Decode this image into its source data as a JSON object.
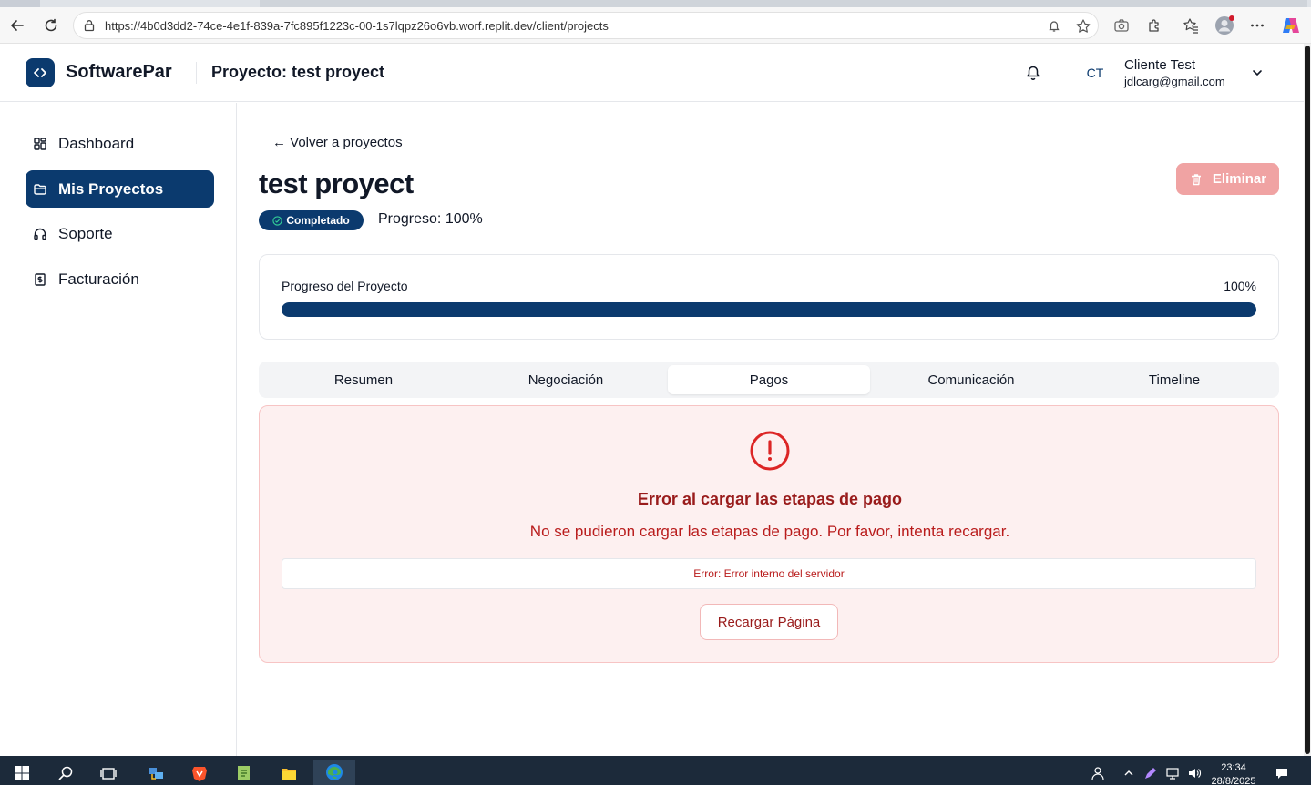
{
  "browser": {
    "url": "https://4b0d3dd2-74ce-4e1f-839a-7fc895f1223c-00-1s7lqpz26o6vb.worf.replit.dev/client/projects",
    "icons": [
      "back-icon",
      "refresh-icon",
      "lock-icon",
      "read-aloud-icon",
      "favorite-icon",
      "screenshot-icon",
      "extensions-icon",
      "favorites-icon",
      "profile-icon",
      "more-icon",
      "copilot-icon"
    ]
  },
  "header": {
    "brand": "SoftwarePar",
    "title": "Proyecto: test proyect",
    "user_initials": "CT",
    "user_name": "Cliente Test",
    "user_email": "jdlcarg@gmail.com"
  },
  "sidebar": {
    "items": [
      {
        "label": "Dashboard",
        "icon": "grid-icon",
        "active": false
      },
      {
        "label": "Mis Proyectos",
        "icon": "folder-icon",
        "active": true
      },
      {
        "label": "Soporte",
        "icon": "headphones-icon",
        "active": false
      },
      {
        "label": "Facturación",
        "icon": "receipt-icon",
        "active": false
      }
    ]
  },
  "main": {
    "back_link": "← Volver a proyectos",
    "project_title": "test proyect",
    "delete_label": "Eliminar",
    "status_badge": "Completado",
    "progress_text": "Progreso: 100%",
    "progress_card": {
      "label": "Progreso del Proyecto",
      "percent_label": "100%",
      "value": 100
    },
    "tabs": [
      "Resumen",
      "Negociación",
      "Pagos",
      "Comunicación",
      "Timeline"
    ],
    "active_tab": "Pagos",
    "error": {
      "title": "Error al cargar las etapas de pago",
      "description": "No se pudieron cargar las etapas de pago. Por favor, intenta recargar.",
      "detail": "Error: Error interno del servidor",
      "reload_label": "Recargar Página"
    }
  },
  "taskbar": {
    "time": "23:34",
    "date": "28/8/2025"
  },
  "colors": {
    "primary": "#0b3a6e",
    "error_text": "#991b1b",
    "error_bg": "#fdf0f0",
    "delete_bg": "#f0a3a3"
  }
}
